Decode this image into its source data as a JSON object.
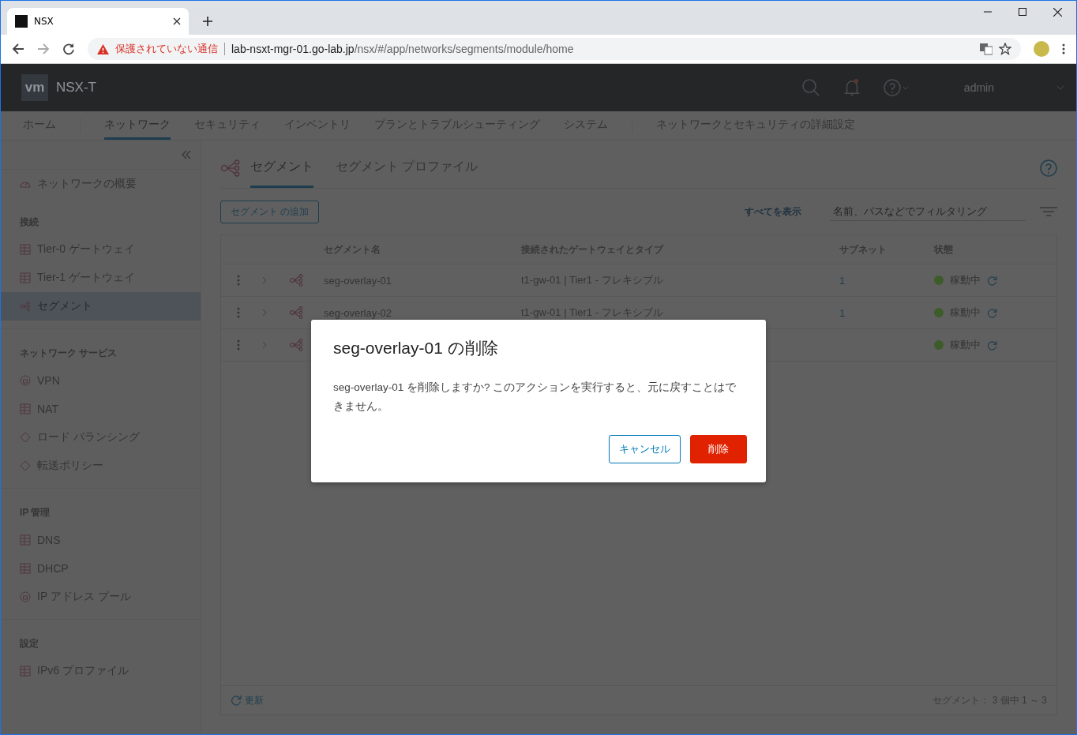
{
  "browser": {
    "tab_title": "NSX",
    "url_warning": "保護されていない通信",
    "url_host": "lab-nsxt-mgr-01.go-lab.jp",
    "url_path": "/nsx/#/app/networks/segments/module/home"
  },
  "header": {
    "logo": "vm",
    "product": "NSX-T",
    "user": "admin"
  },
  "nav": [
    {
      "label": "ホーム",
      "selected": false
    },
    {
      "label": "ネットワーク",
      "selected": true
    },
    {
      "label": "セキュリティ",
      "selected": false
    },
    {
      "label": "インベントリ",
      "selected": false
    },
    {
      "label": "プランとトラブルシューティング",
      "selected": false
    },
    {
      "label": "システム",
      "selected": false
    },
    {
      "label": "ネットワークとセキュリティの詳細設定",
      "selected": false
    }
  ],
  "sidebar": [
    {
      "kind": "link",
      "label": "ネットワークの概要",
      "selected": false
    },
    {
      "kind": "heading",
      "label": "接続"
    },
    {
      "kind": "link",
      "label": "Tier-0 ゲートウェイ",
      "selected": false
    },
    {
      "kind": "link",
      "label": "Tier-1 ゲートウェイ",
      "selected": false
    },
    {
      "kind": "link",
      "label": "セグメント",
      "selected": true
    },
    {
      "kind": "heading",
      "label": "ネットワーク サービス"
    },
    {
      "kind": "link",
      "label": "VPN",
      "selected": false
    },
    {
      "kind": "link",
      "label": "NAT",
      "selected": false
    },
    {
      "kind": "link",
      "label": "ロード バランシング",
      "selected": false
    },
    {
      "kind": "link",
      "label": "転送ポリシー",
      "selected": false
    },
    {
      "kind": "heading",
      "label": "IP 管理"
    },
    {
      "kind": "link",
      "label": "DNS",
      "selected": false
    },
    {
      "kind": "link",
      "label": "DHCP",
      "selected": false
    },
    {
      "kind": "link",
      "label": "IP アドレス プール",
      "selected": false
    },
    {
      "kind": "heading",
      "label": "設定"
    },
    {
      "kind": "link",
      "label": "IPv6 プロファイル",
      "selected": false
    }
  ],
  "page_tabs": [
    {
      "label": "セグメント",
      "selected": true
    },
    {
      "label": "セグメント プロファイル",
      "selected": false
    }
  ],
  "toolbar": {
    "add_button": "セグメント の追加",
    "show_all": "すべてを表示",
    "filter_placeholder": "名前、パスなどでフィルタリング"
  },
  "table": {
    "columns": [
      "セグメント名",
      "接続されたゲートウェイとタイプ",
      "サブネット",
      "状態"
    ],
    "rows": [
      {
        "name": "seg-overlay-01",
        "gateway": "t1-gw-01 | Tier1 - フレキシブル",
        "subnet": "1",
        "status": "稼動中",
        "color": "#3d5c2a"
      },
      {
        "name": "seg-overlay-02",
        "gateway": "t1-gw-01 | Tier1 - フレキシブル",
        "subnet": "1",
        "status": "稼動中",
        "color": "#3d5c2a"
      },
      {
        "status": "稼動中",
        "color": "#3d5c2a"
      }
    ]
  },
  "footer": {
    "refresh": "更新",
    "count": "セグメント： 3 個中 1 ～ 3"
  },
  "dialog": {
    "title": "seg-overlay-01 の削除",
    "message": "seg-overlay-01 を削除しますか? このアクションを実行すると、元に戻すことはできません。",
    "cancel": "キャンセル",
    "delete": "削除"
  }
}
